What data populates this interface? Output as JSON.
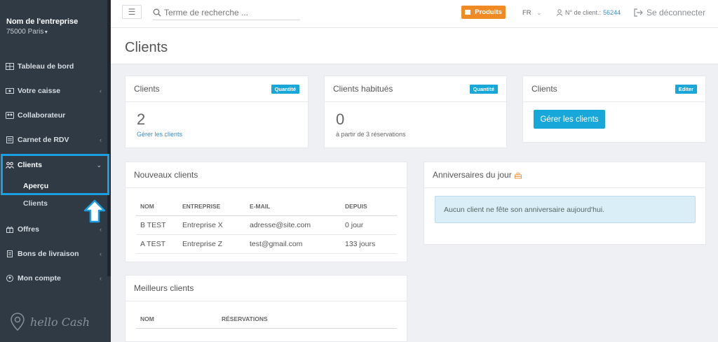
{
  "sidebar": {
    "company_name": "Nom de l'entreprise",
    "company_city": "75000 Paris",
    "items": [
      {
        "label": "Tableau de bord",
        "icon": "dashboard-icon",
        "has_chevron": false
      },
      {
        "label": "Votre caisse",
        "icon": "cash-register-icon",
        "has_chevron": true
      },
      {
        "label": "Collaborateur",
        "icon": "staff-icon",
        "has_chevron": false
      },
      {
        "label": "Carnet de RDV",
        "icon": "calendar-icon",
        "has_chevron": true
      },
      {
        "label": "Clients",
        "icon": "users-icon",
        "has_chevron": true
      },
      {
        "label": "Offres",
        "icon": "gift-icon",
        "has_chevron": true
      },
      {
        "label": "Bons de livraison",
        "icon": "delivery-note-icon",
        "has_chevron": true
      },
      {
        "label": "Mon compte",
        "icon": "account-icon",
        "has_chevron": true
      }
    ],
    "sub_items": [
      {
        "label": "Aperçu",
        "active": true
      },
      {
        "label": "Clients",
        "active": false
      }
    ],
    "logo_text": "hello Cash"
  },
  "topbar": {
    "search_placeholder": "Terme de recherche ...",
    "products_label": "Produits",
    "language": "FR",
    "client_number_label": "N° de client.:",
    "client_number": "56244",
    "logout_label": "Se déconnecter"
  },
  "page": {
    "title": "Clients"
  },
  "cards": {
    "clients": {
      "title": "Clients",
      "badge": "Quantité",
      "value": "2",
      "link": "Gérer les clients"
    },
    "regulars": {
      "title": "Clients habitués",
      "badge": "Quantité",
      "value": "0",
      "caption": "à partir de 3 réservations"
    },
    "manage": {
      "title": "Clients",
      "badge": "Editer",
      "button": "Gérer les clients"
    }
  },
  "new_clients": {
    "title": "Nouveaux clients",
    "columns": [
      "NOM",
      "ENTREPRISE",
      "E-MAIL",
      "DEPUIS"
    ],
    "rows": [
      [
        "B TEST",
        "Entreprise X",
        "adresse@site.com",
        "0 jour"
      ],
      [
        "A TEST",
        "Entreprise Z",
        "test@gmail.com",
        "133 jours"
      ]
    ]
  },
  "birthdays": {
    "title": "Anniversaires du jour",
    "message": "Aucun client ne fête son anniversaire aujourd'hui."
  },
  "best_clients": {
    "title": "Meilleurs clients",
    "columns": [
      "NOM",
      "RÉSERVATIONS"
    ]
  },
  "colors": {
    "sidebar_bg": "#2f3a45",
    "accent_blue": "#18a7d9",
    "highlight_blue": "#1a9fe0",
    "orange": "#f08a24"
  }
}
